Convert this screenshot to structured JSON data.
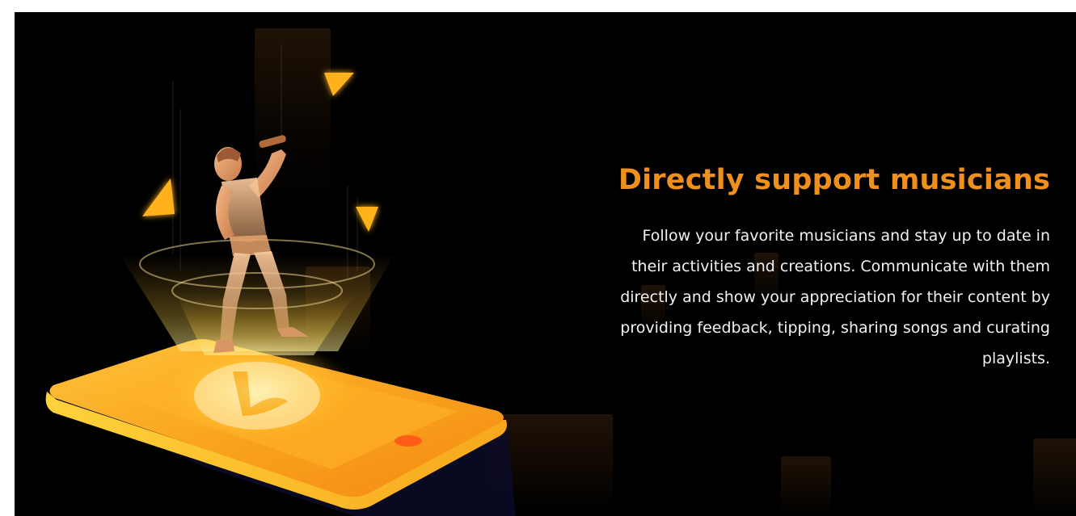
{
  "section": {
    "heading": "Directly support musicians",
    "body_lines": [
      "Follow your favorite musicians and stay up to date in",
      "their activities and creations. Communicate with them",
      "directly and show your appreciation for their content by",
      "providing feedback, tipping, sharing songs and curating",
      "playlists."
    ]
  },
  "illustration": {
    "subject": "singer hologram above smartphone",
    "icons": [
      "triangle-icon",
      "triangle-icon",
      "triangle-icon",
      "music-note-icon"
    ]
  },
  "colors": {
    "background": "#000000",
    "accent": "#f0901c",
    "text": "#f2f2f2",
    "phone": "#f7a21a"
  }
}
